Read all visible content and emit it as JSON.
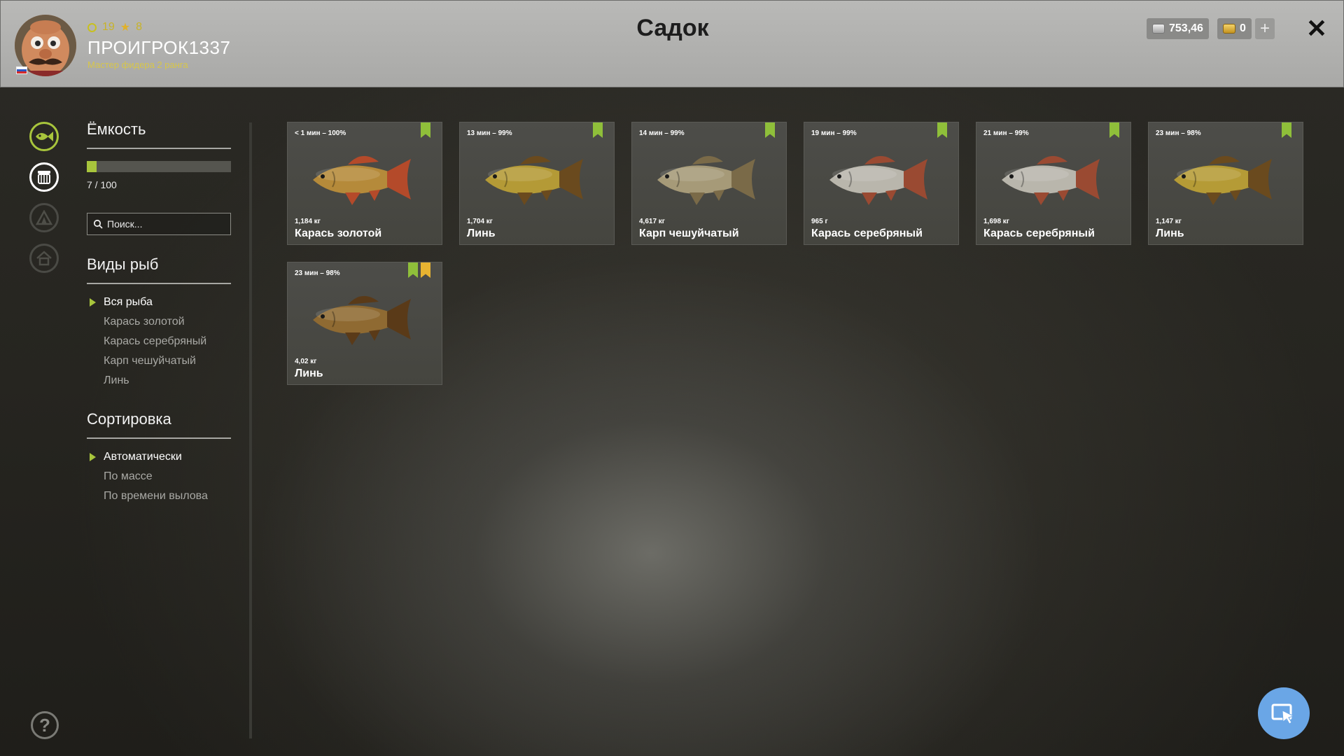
{
  "header": {
    "title": "Садок",
    "player": {
      "level": "19",
      "stars": "8",
      "name": "ПРОИГРОК1337",
      "rank": "Мастер фидера 2 ранга"
    },
    "silver": "753,46",
    "gold": "0"
  },
  "capacity": {
    "title": "Ёмкость",
    "text": "7 / 100",
    "fill_fraction": 0.07
  },
  "search": {
    "placeholder": "Поиск..."
  },
  "species": {
    "title": "Виды рыб",
    "items": [
      "Вся рыба",
      "Карась золотой",
      "Карась серебряный",
      "Карп чешуйчатый",
      "Линь"
    ],
    "active_index": 0
  },
  "sort": {
    "title": "Сортировка",
    "items": [
      "Автоматически",
      "По массе",
      "По времени вылова"
    ],
    "active_index": 0
  },
  "fish": [
    {
      "time": "< 1 мин – 100%",
      "weight": "1,184 кг",
      "name": "Карась золотой",
      "body_color": "#b58a3a",
      "fin_color": "#b44a2a",
      "gold_mark": false
    },
    {
      "time": "13 мин – 99%",
      "weight": "1,704 кг",
      "name": "Линь",
      "body_color": "#b49a36",
      "fin_color": "#6a4a1e",
      "gold_mark": false
    },
    {
      "time": "14 мин – 99%",
      "weight": "4,617 кг",
      "name": "Карп чешуйчатый",
      "body_color": "#a69a78",
      "fin_color": "#7a6a48",
      "gold_mark": false
    },
    {
      "time": "19 мин – 99%",
      "weight": "965 г",
      "name": "Карась серебряный",
      "body_color": "#b9b6ac",
      "fin_color": "#9a4a32",
      "gold_mark": false
    },
    {
      "time": "21 мин – 99%",
      "weight": "1,698 кг",
      "name": "Карась серебряный",
      "body_color": "#b9b6ac",
      "fin_color": "#9a4a32",
      "gold_mark": false
    },
    {
      "time": "23 мин – 98%",
      "weight": "1,147 кг",
      "name": "Линь",
      "body_color": "#b59b36",
      "fin_color": "#6a4a1e",
      "gold_mark": false
    },
    {
      "time": "23 мин – 98%",
      "weight": "4,02 кг",
      "name": "Линь",
      "body_color": "#8f6a32",
      "fin_color": "#5a3a18",
      "gold_mark": true
    }
  ]
}
